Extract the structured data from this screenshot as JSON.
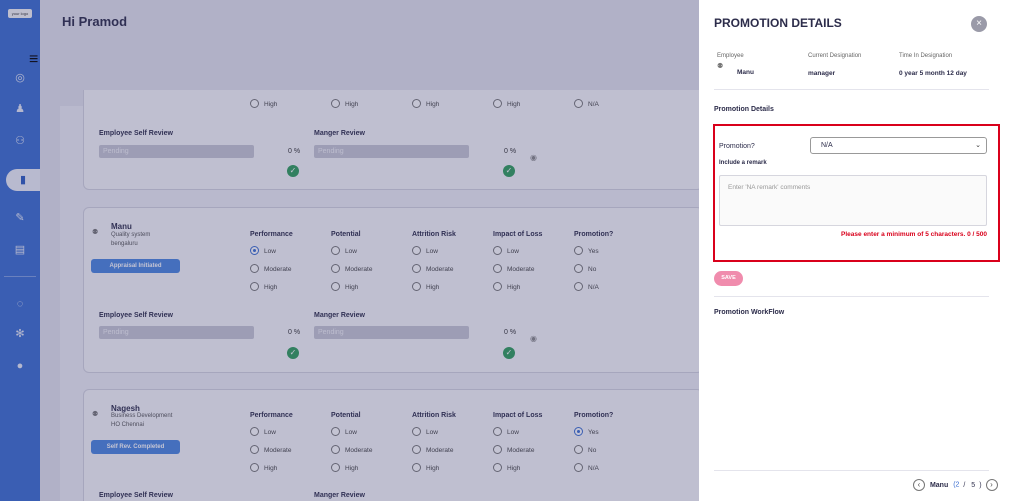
{
  "app": {
    "logo": "your logo",
    "greeting": "Hi Pramod"
  },
  "sidebar": {
    "icons": [
      "dashboard-icon",
      "team-icon",
      "org-icon",
      "appraisal-icon",
      "goals-icon",
      "reports-icon",
      "chat-icon",
      "settings-icon",
      "user-icon"
    ]
  },
  "columns": {
    "performance": "Performance",
    "potential": "Potential",
    "attrition": "Attrition Risk",
    "impact": "Impact of Loss",
    "promotion": "Promotion?"
  },
  "levels": [
    "Low",
    "Moderate",
    "High"
  ],
  "promotion_options": [
    "Yes",
    "No",
    "N/A"
  ],
  "review": {
    "self_label": "Employee Self Review",
    "manager_label": "Manger Review",
    "pending": "Pending",
    "pct": "0 %"
  },
  "top_card": {
    "high": "High",
    "na": "N/A"
  },
  "employees": [
    {
      "name": "Manu",
      "dept": "Quality system",
      "location": "bengaluru",
      "status": "Appraisal Initiated"
    },
    {
      "name": "Nagesh",
      "dept": "Business Development",
      "location": "HO Chennai",
      "status": "Self Rev. Completed"
    }
  ],
  "panel": {
    "title": "PROMOTION DETAILS",
    "close": "×",
    "employee_label": "Employee",
    "employee_value": "Manu",
    "designation_label": "Current Designation",
    "designation_value": "manager",
    "time_label": "Time In Designation",
    "time_value": "0 year 5 month 12 day",
    "section_details": "Promotion Details",
    "promotion_label": "Promotion?",
    "promotion_value": "N/A",
    "remark_label": "Include a remark",
    "remark_placeholder": "Enter 'NA remark' comments",
    "error": "Please enter a minimum of 5 characters. 0 / 500",
    "save": "SAVE",
    "workflow": "Promotion WorkFlow",
    "pager_name": "Manu",
    "pager_current": "2",
    "pager_sep": "/",
    "pager_total": "5"
  },
  "colors": {
    "sidebar": "#3a6ed1",
    "accent": "#3a6ed1",
    "success": "#2f9e5b",
    "error": "#d9001b",
    "save": "#f08cad"
  }
}
